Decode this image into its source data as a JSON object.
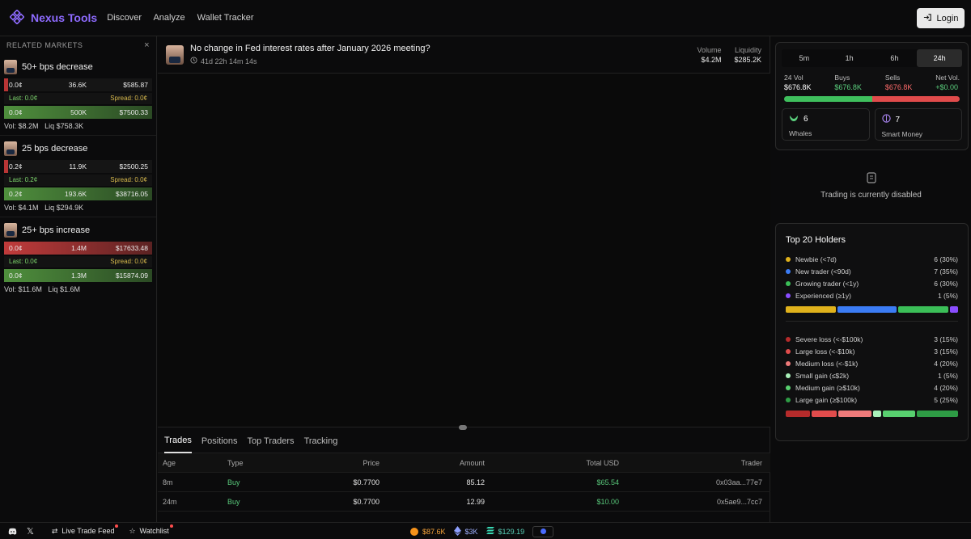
{
  "header": {
    "brand": "Nexus Tools",
    "nav": [
      "Discover",
      "Analyze",
      "Wallet Tracker"
    ],
    "login": "Login"
  },
  "left": {
    "title": "RELATED MARKETS",
    "markets": [
      {
        "name": "50+ bps decrease",
        "ask": {
          "price": "0.0¢",
          "size": "36.6K",
          "total": "$585.87"
        },
        "last": "Last: 0.0¢",
        "spread": "Spread: 0.0¢",
        "bid": {
          "price": "0.0¢",
          "size": "500K",
          "total": "$7500.33"
        },
        "foot": {
          "vol_label": "Vol:",
          "vol": "$8.2M",
          "liq_label": "Liq",
          "liq": "$758.3K"
        }
      },
      {
        "name": "25 bps decrease",
        "ask": {
          "price": "0.2¢",
          "size": "11.9K",
          "total": "$2500.25"
        },
        "last": "Last: 0.2¢",
        "spread": "Spread: 0.0¢",
        "bid": {
          "price": "0.2¢",
          "size": "193.6K",
          "total": "$38716.05"
        },
        "foot": {
          "vol_label": "Vol:",
          "vol": "$4.1M",
          "liq_label": "Liq",
          "liq": "$294.9K"
        }
      },
      {
        "name": "25+ bps increase",
        "ask": {
          "price": "0.0¢",
          "size": "1.4M",
          "total": "$17633.48"
        },
        "last": "Last: 0.0¢",
        "spread": "Spread: 0.0¢",
        "bid": {
          "price": "0.0¢",
          "size": "1.3M",
          "total": "$15874.09"
        },
        "foot": {
          "vol_label": "Vol:",
          "vol": "$11.6M",
          "liq_label": "Liq",
          "liq": "$1.6M"
        }
      }
    ]
  },
  "center": {
    "title": "No change in Fed interest rates after January 2026 meeting?",
    "countdown": "41d 22h 14m 14s",
    "stats": {
      "volume_label": "Volume",
      "volume": "$4.2M",
      "liq_label": "Liquidity",
      "liq": "$285.2K"
    },
    "tabs": [
      "Trades",
      "Positions",
      "Top Traders",
      "Tracking"
    ],
    "columns": [
      "Age",
      "Type",
      "Price",
      "Amount",
      "Total USD",
      "Trader"
    ],
    "rows": [
      {
        "age": "8m",
        "type": "Buy",
        "price": "$0.7700",
        "amount": "85.12",
        "total": "$65.54",
        "trader": "0x03aa...77e7"
      },
      {
        "age": "24m",
        "type": "Buy",
        "price": "$0.7700",
        "amount": "12.99",
        "total": "$10.00",
        "trader": "0x5ae9...7cc7"
      }
    ]
  },
  "right": {
    "timeframes": [
      "5m",
      "1h",
      "6h",
      "24h"
    ],
    "active_timeframe": "24h",
    "kpis": [
      {
        "label": "24 Vol",
        "value": "$676.8K"
      },
      {
        "label": "Buys",
        "value": "$676.8K"
      },
      {
        "label": "Sells",
        "value": "$676.8K"
      },
      {
        "label": "Net Vol.",
        "value": "+$0.00"
      }
    ],
    "buy_sell_split": {
      "buy": 0.5,
      "sell": 0.5
    },
    "whales": {
      "count": "6",
      "label": "Whales"
    },
    "smart_money": {
      "count": "7",
      "label": "Smart Money"
    },
    "trading_disabled": "Trading is currently disabled",
    "holders_title": "Top 20 Holders",
    "experience": [
      {
        "label": "Newbie (<7d)",
        "value": "6 (30%)",
        "color": "#e0b21c",
        "pct": 30
      },
      {
        "label": "New trader (<90d)",
        "value": "7 (35%)",
        "color": "#3b7cf5",
        "pct": 35
      },
      {
        "label": "Growing trader (<1y)",
        "value": "6 (30%)",
        "color": "#3bbf58",
        "pct": 30
      },
      {
        "label": "Experienced (≥1y)",
        "value": "1 (5%)",
        "color": "#8a4dff",
        "pct": 5
      }
    ],
    "pnl": [
      {
        "label": "Severe loss (<-$100k)",
        "value": "3 (15%)",
        "color": "#b52b2b",
        "pct": 15
      },
      {
        "label": "Large loss (<-$10k)",
        "value": "3 (15%)",
        "color": "#e14c4c",
        "pct": 15
      },
      {
        "label": "Medium loss (<-$1k)",
        "value": "4 (20%)",
        "color": "#ee7a7a",
        "pct": 20
      },
      {
        "label": "Small gain (≤$2k)",
        "value": "1 (5%)",
        "color": "#a9f0b9",
        "pct": 5
      },
      {
        "label": "Medium gain (≥$10k)",
        "value": "4 (20%)",
        "color": "#58d06f",
        "pct": 20
      },
      {
        "label": "Large gain (≥$100k)",
        "value": "5 (25%)",
        "color": "#2e9c45",
        "pct": 25
      }
    ]
  },
  "bottom": {
    "live_feed": "Live Trade Feed",
    "watchlist": "Watchlist",
    "btc": "$87.6K",
    "eth": "$3K",
    "sol": "$129.19"
  }
}
